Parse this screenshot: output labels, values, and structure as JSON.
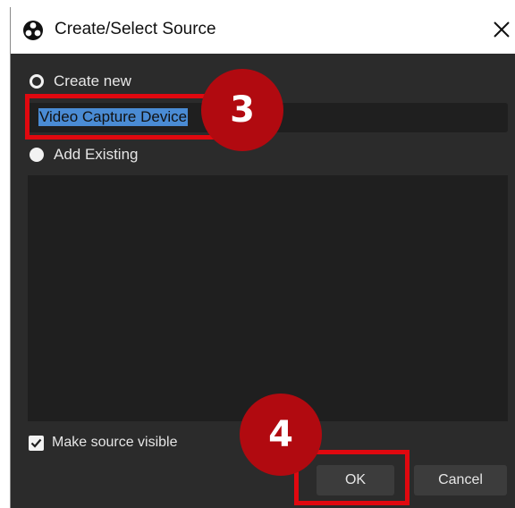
{
  "window": {
    "title": "Create/Select Source",
    "app_icon": "obs-logo-icon",
    "close_icon": "close-icon"
  },
  "options": {
    "create_new_label": "Create new",
    "create_new_selected": true,
    "source_name_value": "Video Capture Device",
    "add_existing_label": "Add Existing",
    "add_existing_selected": false
  },
  "footer": {
    "make_visible_label": "Make source visible",
    "make_visible_checked": true,
    "ok_label": "OK",
    "cancel_label": "Cancel"
  },
  "annotations": {
    "step_3": "3",
    "step_4": "4"
  },
  "colors": {
    "dialog_bg": "#2b2b2b",
    "field_bg": "#1f1f1f",
    "selection": "#4a8bd4",
    "highlight": "#e0080f",
    "step_badge": "#b10a10"
  }
}
